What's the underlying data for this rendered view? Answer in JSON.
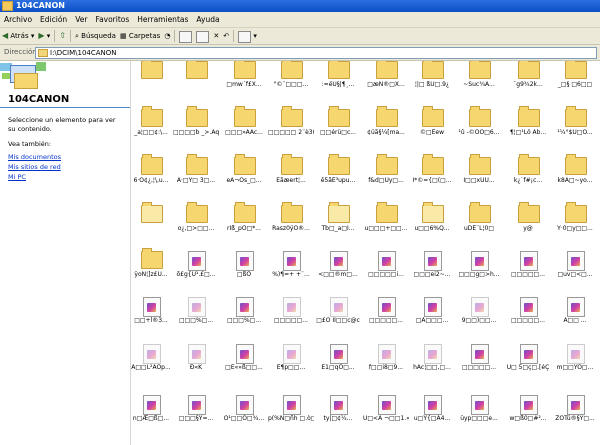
{
  "window": {
    "title": "104CANON"
  },
  "menu": [
    "Archivo",
    "Edición",
    "Ver",
    "Favoritos",
    "Herramientas",
    "Ayuda"
  ],
  "toolbar": {
    "back": "Atrás",
    "search": "Búsqueda",
    "folders": "Carpetas"
  },
  "address": {
    "label": "Dirección",
    "path": "I:\\DCIM\\104CANON"
  },
  "tasks": {
    "title": "104CANON",
    "description": "Seleccione un elemento para ver su contenido.",
    "see_also": "Vea también:",
    "links": [
      "Mis documentos",
      "Mis sitios de red",
      "Mi PC"
    ]
  },
  "items": [
    {
      "label": ""
    },
    {
      "label": ""
    },
    {
      "label": "□mw´f£X..."
    },
    {
      "label": "\"©¨□□□..."
    },
    {
      "label": ":=ëÜ§|¶¸..."
    },
    {
      "label": "□æÑ®□X..."
    },
    {
      "label": "¦|□ ßU□.9¿"
    },
    {
      "label": "~Suc¾Ã..."
    },
    {
      "label": "¯g9¾2k..."
    },
    {
      "label": "_□§ □6□□"
    },
    {
      "label": "_a¦□□¢:\\..."
    },
    {
      "label": "□□□□b _>.Aq\\"
    },
    {
      "label": "□□□»ÂÃc..."
    },
    {
      "label": "□□□□□ 2¨è30.ÝÜ□"
    },
    {
      "label": "□□érü□c..."
    },
    {
      "label": "¢üã§¼[ma..."
    },
    {
      "label": "©□Ëew"
    },
    {
      "label": "¹û -©ÖÕ□6..."
    },
    {
      "label": "¶¦□¹Lö Ab..."
    },
    {
      "label": "¹¼°$U□Ö..."
    },
    {
      "label": "6·Ö¢¿,¦\\,u..."
    },
    {
      "label": "Á·□Ý□ 3□..."
    },
    {
      "label": "eÃ¬Ós_□..."
    },
    {
      "label": "Éãæert¦..."
    },
    {
      "label": "ê5ãË³upu..."
    },
    {
      "label": "f&d□Ûy□..."
    },
    {
      "label": "Ì*©={□(□..."
    },
    {
      "label": "Ì□□xÚÜ..."
    },
    {
      "label": "k¿`f#¡c..."
    },
    {
      "label": "k8Â□~yo..."
    },
    {
      "label": ""
    },
    {
      "label": "o¿,□>□□..."
    },
    {
      "label": "rÌß_pO□*..."
    },
    {
      "label": "Rasz0ÿÖ®..."
    },
    {
      "label": "Tb□_a□I..."
    },
    {
      "label": "u□□□+□□..."
    },
    {
      "label": "u□□6%Q..."
    },
    {
      "label": "uDË¨L¦0□"
    },
    {
      "label": "y@"
    },
    {
      "label": "Y·0□y□□..."
    },
    {
      "label": "ÿoÑ¦]z£Ú..."
    },
    {
      "label": "õ£g{Ü¹.£□..."
    },
    {
      "label": "□ßÒ"
    },
    {
      "label": "%)¶=+ +¨..."
    },
    {
      "label": "<□□®m□..."
    },
    {
      "label": "□□□□□i..."
    },
    {
      "label": "□□□ei2~..."
    },
    {
      "label": "□□□g□>h..."
    },
    {
      "label": "□□□□□..."
    },
    {
      "label": "□uv□<□..."
    },
    {
      "label": "□□+l®3..."
    },
    {
      "label": "□□□%□..."
    },
    {
      "label": "□□□%□..."
    },
    {
      "label": "□□□□□..."
    },
    {
      "label": "□£Ö ÍÍ□□c@c"
    },
    {
      "label": "□□□□□..."
    },
    {
      "label": "□Ä□□□..."
    },
    {
      "label": "9□□)□□..."
    },
    {
      "label": "□□□□□..."
    },
    {
      "label": "Á□□ ..."
    },
    {
      "label": "Ã□□L²ÂÖp..."
    },
    {
      "label": "Ð«K"
    },
    {
      "label": "□Ê«»ß□□..."
    },
    {
      "label": "Ë¶p□□..."
    },
    {
      "label": "È1□qÔ□..."
    },
    {
      "label": "f□□i8□9..."
    },
    {
      "label": "hÀc¦□□,□..."
    },
    {
      "label": "□□□□□..."
    },
    {
      "label": "Ú□ 5□ç□.[éÇ"
    },
    {
      "label": "m□□YÕ□..."
    },
    {
      "label": "n□Æ□ß□..."
    },
    {
      "label": "□□□§Ÿ=..."
    },
    {
      "label": "Ó¹□□Ö□¾..."
    },
    {
      "label": "p(%Ñ□ñh □.ò□□"
    },
    {
      "label": "ty|□¢¼..."
    },
    {
      "label": "Ù□<À ¬□□1.«"
    },
    {
      "label": "u□Ÿ{□Ã4..."
    },
    {
      "label": "üyp□□□e..."
    },
    {
      "label": "w□ß0□#²..."
    },
    {
      "label": "ZÖTú®§Y□..."
    }
  ]
}
